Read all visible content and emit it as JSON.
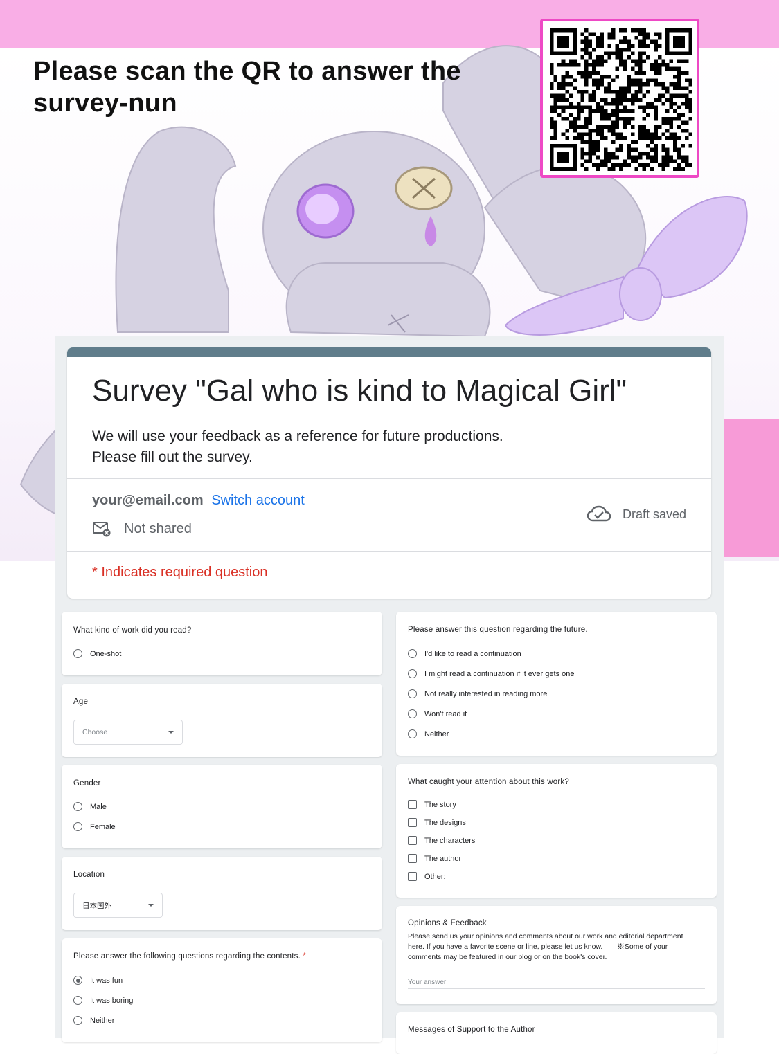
{
  "header": {
    "headline": "Please scan the QR to answer the survey-nun"
  },
  "form": {
    "title": "Survey \"Gal who is kind to Magical Girl\"",
    "description_line1": "We will use your feedback as a reference for future productions.",
    "description_line2": "Please fill out the survey.",
    "account_email": "your@email.com",
    "switch_account": "Switch account",
    "not_shared": "Not shared",
    "draft_status": "Draft saved",
    "required_note": "* Indicates required question",
    "accent_color": "#607d8b"
  },
  "questions_left": {
    "work_read": {
      "title": "What kind of work did you read?",
      "options": [
        "One-shot"
      ]
    },
    "age": {
      "title": "Age",
      "select_value": "Choose"
    },
    "gender": {
      "title": "Gender",
      "options": [
        "Male",
        "Female"
      ]
    },
    "location": {
      "title": "Location",
      "select_value": "日本国外"
    },
    "contents": {
      "title": "Please answer the following questions regarding the contents.",
      "required_mark": "*",
      "options": [
        "It was fun",
        "It was boring",
        "Neither"
      ],
      "selected": "It was fun"
    }
  },
  "questions_right": {
    "future": {
      "title": "Please answer this question regarding the future.",
      "options": [
        "I'd like to read a continuation",
        "I might read a continuation if it ever gets one",
        "Not really interested in reading more",
        "Won't read it",
        "Neither"
      ]
    },
    "attention": {
      "title": "What caught your attention about this work?",
      "options": [
        "The story",
        "The designs",
        "The characters",
        "The author",
        "Other:"
      ]
    },
    "feedback": {
      "title": "Opinions & Feedback",
      "description": "Please send us your opinions and comments about our work and editorial department here. If you have a favorite scene or line, please let us know.　　※Some of your comments may be featured in our blog or on the book's cover.",
      "placeholder": "Your answer"
    },
    "support": {
      "title": "Messages of Support to the Author"
    }
  }
}
